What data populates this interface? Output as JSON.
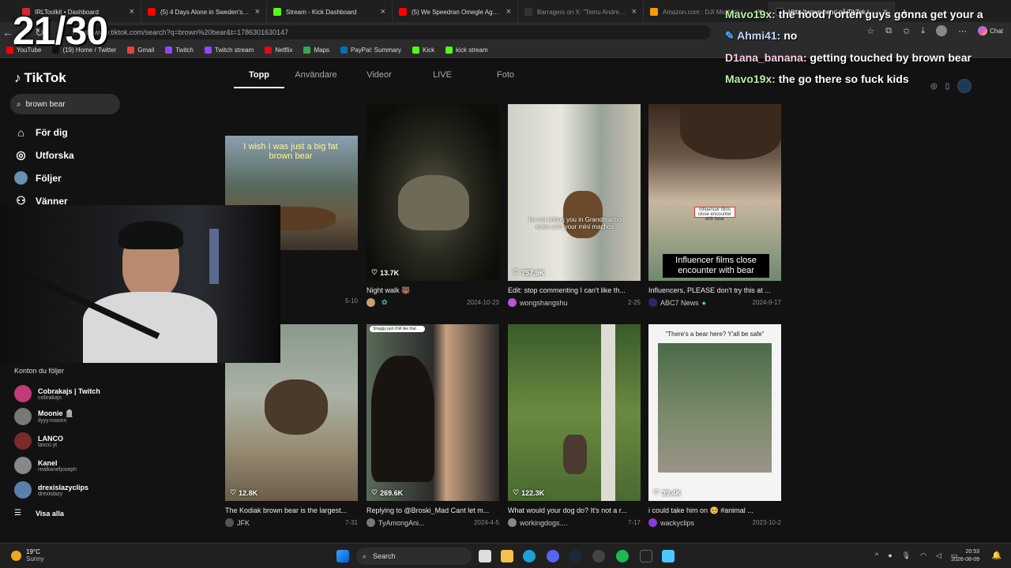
{
  "browser": {
    "tabs": [
      {
        "label": "IRLToolkit • Dashboard",
        "color": "#d8282f"
      },
      {
        "label": "(5) 4 Days Alone in Sweden's Wild",
        "color": "#ff0000"
      },
      {
        "label": "Stream - Kick Dashboard",
        "color": "#53fc18"
      },
      {
        "label": "(5) We Speedran Omegle Against",
        "color": "#ff0000"
      },
      {
        "label": "Barragers on X: \"Temu Andrew Ta",
        "color": "#333333"
      },
      {
        "label": "Amazon.com : DJI Mic Mini (2 TX",
        "color": "#ff9900"
      },
      {
        "label": "Hitta 'brown bear' på TikTok | Tik",
        "color": "#111111"
      }
    ],
    "url": "https://www.tiktok.com/search?q=brown%20bear&t=1786301630147",
    "chat_label": "Chat",
    "bookmarks": [
      {
        "label": "YouTube",
        "color": "#ff0000"
      },
      {
        "label": "(19) Home / Twitter",
        "color": "#111111"
      },
      {
        "label": "Gmail",
        "color": "#ea4335"
      },
      {
        "label": "Twitch",
        "color": "#9146ff"
      },
      {
        "label": "Twitch stream",
        "color": "#9146ff"
      },
      {
        "label": "Netflix",
        "color": "#e50914"
      },
      {
        "label": "Maps",
        "color": "#34a853"
      },
      {
        "label": "PayPal: Summary",
        "color": "#0070ba"
      },
      {
        "label": "Kick",
        "color": "#53fc18"
      },
      {
        "label": "kick stream",
        "color": "#53fc18"
      }
    ]
  },
  "overlay": {
    "counter": "21/30"
  },
  "tiktok": {
    "logo": "TikTok",
    "search_value": "brown bear",
    "nav": [
      "För dig",
      "Utforska",
      "Följer",
      "Vänner"
    ],
    "tabs": [
      "Topp",
      "Användare",
      "Videor",
      "LIVE",
      "Foto"
    ],
    "following_header": "Konton du följer",
    "following": [
      {
        "name": "Cobrakajs | Twitch",
        "user": "cobrakajs",
        "color": "#c23a7a"
      },
      {
        "name": "Moonie 🪦",
        "user": "ilyyy.moonn",
        "color": "#777777"
      },
      {
        "name": "LANCO",
        "user": "lanco.yt",
        "color": "#7a2a2a"
      },
      {
        "name": "Kanel",
        "user": "realkaneljoseph",
        "color": "#888888"
      },
      {
        "name": "drexislazyclips",
        "user": "drexislazy",
        "color": "#5a7fa8"
      }
    ],
    "see_all": "Visa alla",
    "videos": [
      {
        "likes": "",
        "caption": "",
        "author": "",
        "date": "5-10",
        "overlay": "I wish I was just a big fat brown bear"
      },
      {
        "likes": "13.7K",
        "caption": "Night walk 🐻",
        "author": "",
        "date": "2024-10-23",
        "overlay": ""
      },
      {
        "likes": "757.9K",
        "caption": "Edit: stop commenting I can't like th...",
        "author": "wongshangshu",
        "date": "2-25",
        "overlay": "Im not letting you in Grandmacho even with your mini machos"
      },
      {
        "likes": "",
        "caption": "Influencers, PLEASE don't try this at ...",
        "author": "ABC7 News",
        "date": "2024-9-17",
        "overlay": "Influencer films close encounter with bear"
      },
      {
        "likes": "12.8K",
        "caption": "The Kodiak brown bear is the largest...",
        "author": "JFK",
        "date": "7-31",
        "overlay": ""
      },
      {
        "likes": "269.6K",
        "caption": "Replying to @Broski_Mad Cant let m...",
        "author": "TyAmongAni...",
        "date": "2024-4-5",
        "overlay": "Shaggy just chill like that"
      },
      {
        "likes": "122.3K",
        "caption": "What would your dog do? It's not a r...",
        "author": "workingdogs....",
        "date": "7-17",
        "overlay": ""
      },
      {
        "likes": "39.4K",
        "caption": "i could take him on 🥺 #animal ...",
        "author": "wackyclips",
        "date": "2023-10-2",
        "overlay": "“There's a bear here? Y'all be safe”"
      }
    ]
  },
  "chat": [
    {
      "name": "Mavo19x:",
      "text": "the hood / orten guys gonna get your a"
    },
    {
      "name": "Ahmi41:",
      "text": "no"
    },
    {
      "name": "D1ana_banana:",
      "text": "getting touched by brown bear"
    },
    {
      "name": "Mavo19x:",
      "text": "the go there so fuck kids"
    }
  ],
  "taskbar": {
    "temp": "19°C",
    "condition": "Sunny",
    "search": "Search",
    "time": "20:53",
    "date": "2026-08-09"
  }
}
